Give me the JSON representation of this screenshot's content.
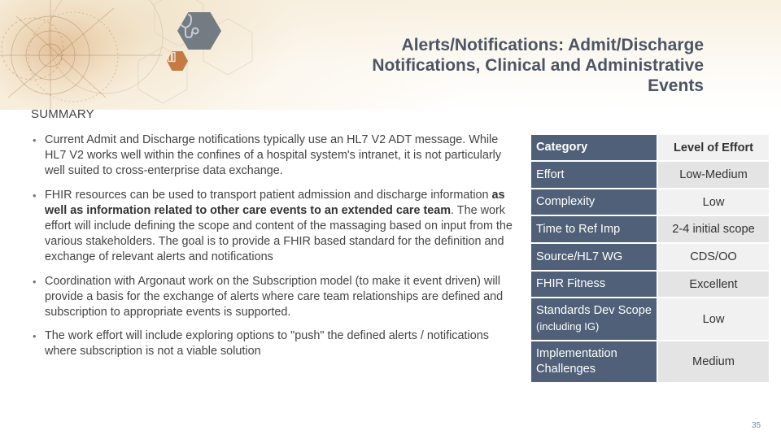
{
  "slide": {
    "title": "Alerts/Notifications: Admit/Discharge Notifications, Clinical and Administrative Events",
    "title_lines": [
      "Alerts/Notifications: Admit/Discharge",
      "Notifications, Clinical and Administrative",
      "Events"
    ],
    "summary_label": "SUMMARY",
    "page_number": "35",
    "icons": [
      "stethoscope-icon",
      "book-icon"
    ]
  },
  "bullets": [
    {
      "parts": [
        {
          "text": "Current Admit and Discharge notifications typically use an HL7 V2 ADT message. While HL7 V2 works well within the confines of a hospital system's intranet, it is not particularly well suited to cross-enterprise data exchange.",
          "bold": false
        }
      ]
    },
    {
      "parts": [
        {
          "text": "FHIR resources can be used to transport patient admission and discharge information ",
          "bold": false
        },
        {
          "text": "as well as information related to other care events to an extended care team",
          "bold": true
        },
        {
          "text": ". The work effort will include defining the scope and content of the massaging based on input from the various stakeholders.  The goal is to provide a FHIR based standard for the definition and exchange of relevant alerts and notifications",
          "bold": false
        }
      ]
    },
    {
      "parts": [
        {
          "text": "Coordination with Argonaut work on the Subscription model (to make it event driven) will provide a basis for the exchange of alerts where  care  team relationships are defined  and subscription  to appropriate events is supported.",
          "bold": false
        }
      ]
    },
    {
      "parts": [
        {
          "text": "The work effort will include exploring options to \"push\" the defined alerts / notifications where subscription is not a viable solution",
          "bold": false
        }
      ]
    }
  ],
  "table": {
    "headers": [
      "Category",
      "Level of Effort"
    ],
    "rows": [
      {
        "category": "Effort",
        "value": "Low-Medium"
      },
      {
        "category": "Complexity",
        "value": "Low"
      },
      {
        "category": "Time to Ref Imp",
        "value": "2-4 initial scope"
      },
      {
        "category": "Source/HL7 WG",
        "value": "CDS/OO"
      },
      {
        "category": "FHIR Fitness",
        "value": "Excellent"
      },
      {
        "category": "Standards Dev Scope",
        "category_suffix": "(including IG)",
        "value": "Low"
      },
      {
        "category": "Implementation Challenges",
        "value": "Medium"
      }
    ]
  },
  "colors": {
    "title": "#4a5565",
    "category_bg": "#4f6078",
    "value_bg_light": "#f1f1f1",
    "value_bg_dark": "#e4e4e4",
    "stethoscope_hex": "#737c83",
    "book_hex": "#c57a44"
  }
}
